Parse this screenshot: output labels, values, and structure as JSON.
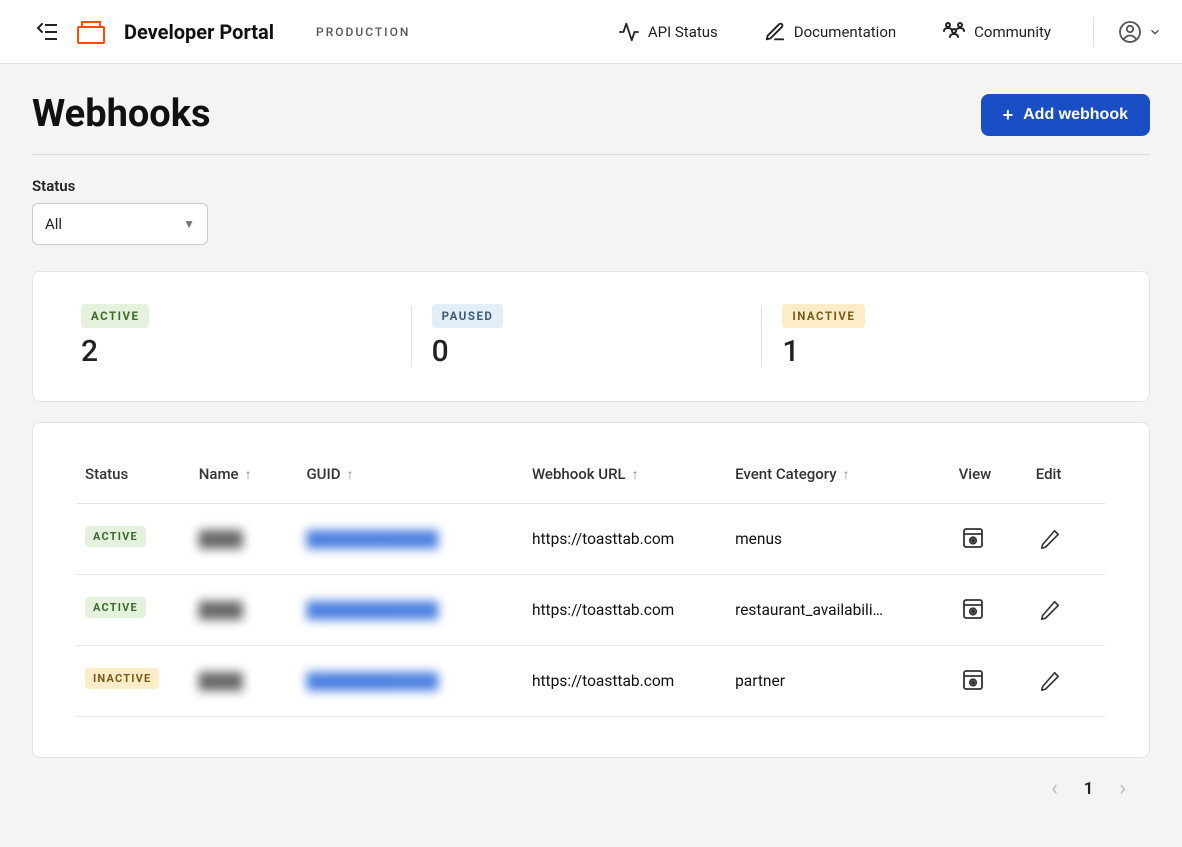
{
  "header": {
    "brand": "Developer Portal",
    "environment": "PRODUCTION",
    "nav": {
      "api_status": "API Status",
      "documentation": "Documentation",
      "community": "Community"
    }
  },
  "page": {
    "title": "Webhooks",
    "add_button": "Add webhook"
  },
  "filter": {
    "label": "Status",
    "value": "All"
  },
  "stats": {
    "active": {
      "label": "ACTIVE",
      "value": "2"
    },
    "paused": {
      "label": "PAUSED",
      "value": "0"
    },
    "inactive": {
      "label": "INACTIVE",
      "value": "1"
    }
  },
  "table": {
    "columns": {
      "status": "Status",
      "name": "Name",
      "guid": "GUID",
      "url": "Webhook URL",
      "category": "Event Category",
      "view": "View",
      "edit": "Edit"
    },
    "rows": [
      {
        "status": "ACTIVE",
        "status_class": "active",
        "name": "—",
        "guid": "—",
        "url": "https://toasttab.com",
        "category": "menus"
      },
      {
        "status": "ACTIVE",
        "status_class": "active",
        "name": "—",
        "guid": "—",
        "url": "https://toasttab.com",
        "category": "restaurant_availabili…"
      },
      {
        "status": "INACTIVE",
        "status_class": "inactive",
        "name": "—",
        "guid": "—",
        "url": "https://toasttab.com",
        "category": "partner"
      }
    ]
  },
  "pagination": {
    "current": "1"
  }
}
